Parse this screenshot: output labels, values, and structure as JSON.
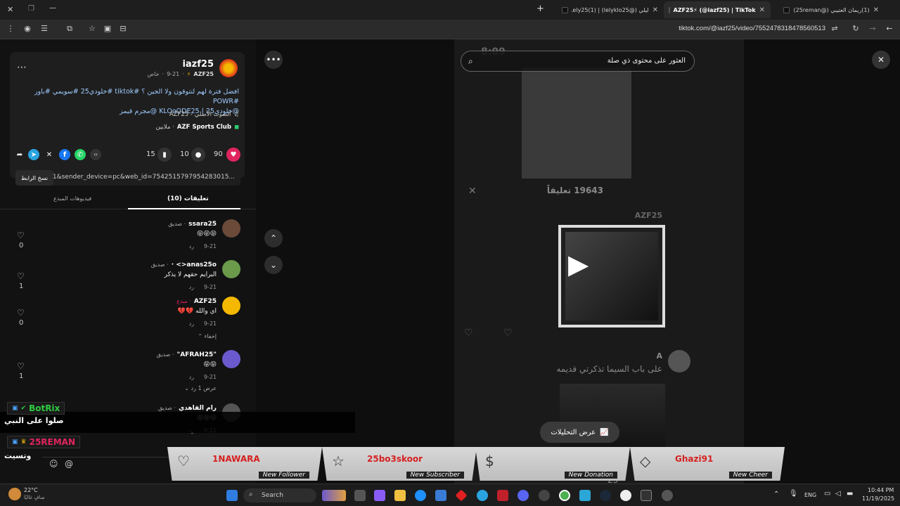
{
  "tabs": [
    {
      "title": "(1)ريمان العتيبي (@25reman)",
      "active": false
    },
    {
      "title": "AZF25⚡ (@iazf25) | TikTok",
      "active": true
    },
    {
      "title": "ليلي (@lelyklo25) | Lely25(1)",
      "active": false
    }
  ],
  "window_controls": {
    "close": "✕",
    "restore": "❐",
    "minimize": "—"
  },
  "address": {
    "url": "tiktok.com/@iazf25/video/7552478318478560513"
  },
  "post": {
    "username": "iazf25",
    "display_name": "AZF25",
    "date": "9-21",
    "privacy": "خاص",
    "caption_line1": "افضل فترة لهم لتتوقون ولا الجين ؟ #tiktok #خلودي25 #سويمي #باور #POWR",
    "caption_line2": "@خلودي25 | KLOoODE25 @مجرم قيمز",
    "sound": "الصوت الأصلي - AZF25",
    "club": "AZF Sports Club",
    "club_suffix": "· ملايين",
    "likes": "90",
    "comments": "10",
    "saves": "15",
    "link_text": "p=1&sender_device=pc&web_id=7542515797954283015...",
    "copy_link": "نسخ الرابط"
  },
  "panel_tabs": {
    "comments": "تعليقات (10)",
    "creator_videos": "فيديوهات المبدع"
  },
  "comments": [
    {
      "name": "ssara25",
      "tag": "· صديق",
      "text": "😝😝😝",
      "date": "9-21",
      "reply": "رد",
      "likes": "0"
    },
    {
      "name": "anas25o<> ·",
      "tag": "· صديق",
      "text": "البرايم حقهم لا يذكر",
      "date": "9-21",
      "reply": "رد",
      "likes": "1"
    },
    {
      "name": "AZF25",
      "tag": "· مبدع",
      "text": "اي والله 💔💔",
      "date": "9-21",
      "reply": "رد",
      "likes": "0",
      "hide": "إخفاء"
    },
    {
      "name": "\"AFRAH25\"",
      "tag": "· صديق",
      "text": "😝😝",
      "date": "9-21",
      "reply": "رد",
      "likes": "1",
      "show_replies": "عرض 1 رد"
    },
    {
      "name": "رام القاهدي",
      "tag": "· صديق",
      "text": "😝😝😝",
      "date": "9-21",
      "reply": "رد",
      "likes": ""
    }
  ],
  "video": {
    "search_placeholder": "العثور على محتوى ذي صلة",
    "time": "8:09",
    "comments_count": "19643 تعليقاً",
    "poster": "AZF25",
    "comment2_user": "A",
    "comment2_text": "على باب السيما تذكرتي قديمه",
    "analytics": "عرض التحليلات",
    "overlay_count": "23"
  },
  "chat": [
    {
      "name": "BotRix",
      "message": "صلوا على النبي",
      "color": "#2ecc40"
    },
    {
      "name": "25REMAN",
      "message": "وتسيت",
      "color": "#e0245e"
    }
  ],
  "alerts": [
    {
      "name": "1NAWARA",
      "label": "New Follower",
      "icon": "heart-icon"
    },
    {
      "name": "25bo3skoor",
      "label": "New Subscriber",
      "icon": "star-icon"
    },
    {
      "name": "",
      "label": "New Donation",
      "icon": "dollar-icon"
    },
    {
      "name": "Ghazi91",
      "label": "New Cheer",
      "icon": "diamond-icon"
    }
  ],
  "taskbar": {
    "weather_temp": "22°C",
    "weather_desc": "صافٍ غالبًا",
    "search": "Search",
    "lang": "ENG",
    "time": "10:44 PM",
    "date": "11/19/2025"
  }
}
